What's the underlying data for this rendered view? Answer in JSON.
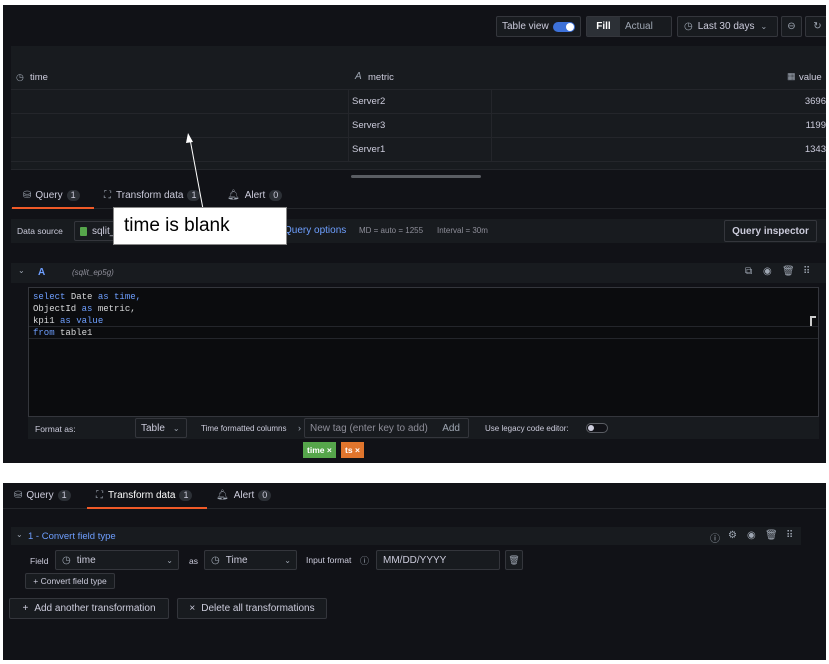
{
  "toolbar": {
    "table_view_label": "Table view",
    "fill_label": "Fill",
    "actual_label": "Actual",
    "time_range_label": "Last 30 days"
  },
  "table": {
    "columns": [
      "time",
      "metric",
      "value"
    ],
    "rows": [
      {
        "time": "",
        "metric": "Server2",
        "value": "3696"
      },
      {
        "time": "",
        "metric": "Server3",
        "value": "1199"
      },
      {
        "time": "",
        "metric": "Server1",
        "value": "1343"
      }
    ]
  },
  "annotation": {
    "text": "time is blank"
  },
  "tabs1": {
    "query": "Query",
    "query_count": "1",
    "transform": "Transform data",
    "transform_count": "1",
    "alert": "Alert",
    "alert_count": "0"
  },
  "datasource": {
    "label": "Data source",
    "name": "sqlit_",
    "query_options": "Query options",
    "md_info": "MD = auto = 1255",
    "interval_info": "Interval = 30m",
    "inspector": "Query inspector"
  },
  "query_row": {
    "letter": "A",
    "source": "(sqlit_ep5g)",
    "code_lines": [
      [
        {
          "t": "select ",
          "k": true
        },
        {
          "t": "Date ",
          "k": false
        },
        {
          "t": "as ",
          "k": true
        },
        {
          "t": "time,",
          "k": true
        }
      ],
      [
        {
          "t": "ObjectId ",
          "k": false
        },
        {
          "t": "as ",
          "k": true
        },
        {
          "t": "metric,",
          "k": false
        }
      ],
      [
        {
          "t": "kpi1 ",
          "k": false
        },
        {
          "t": "as ",
          "k": true
        },
        {
          "t": "value",
          "k": true
        }
      ],
      [
        {
          "t": "from ",
          "k": true
        },
        {
          "t": "table1",
          "k": false
        }
      ]
    ]
  },
  "format": {
    "format_as_label": "Format as:",
    "format_value": "Table",
    "time_cols_label": "Time formatted columns",
    "tag_placeholder": "New tag (enter key to add)",
    "add_label": "Add",
    "legacy_label": "Use legacy code editor:",
    "tags": [
      {
        "label": "time",
        "color": "#56a64b"
      },
      {
        "label": "ts",
        "color": "#e0752d"
      }
    ]
  },
  "tabs2": {
    "query": "Query",
    "query_count": "1",
    "transform": "Transform data",
    "transform_count": "1",
    "alert": "Alert",
    "alert_count": "0"
  },
  "transform": {
    "title": "1 - Convert field type",
    "field_label": "Field",
    "field_value": "time",
    "as_label": "as",
    "as_value": "Time",
    "input_format_label": "Input format",
    "input_format_value": "MM/DD/YYYY",
    "convert_button": "+ Convert field type",
    "add_another": "Add another transformation",
    "delete_all": "Delete all transformations"
  },
  "colors": {
    "accent": "#6e9fff",
    "tab_underline": "#f05a28",
    "panel_bg": "#111217"
  }
}
